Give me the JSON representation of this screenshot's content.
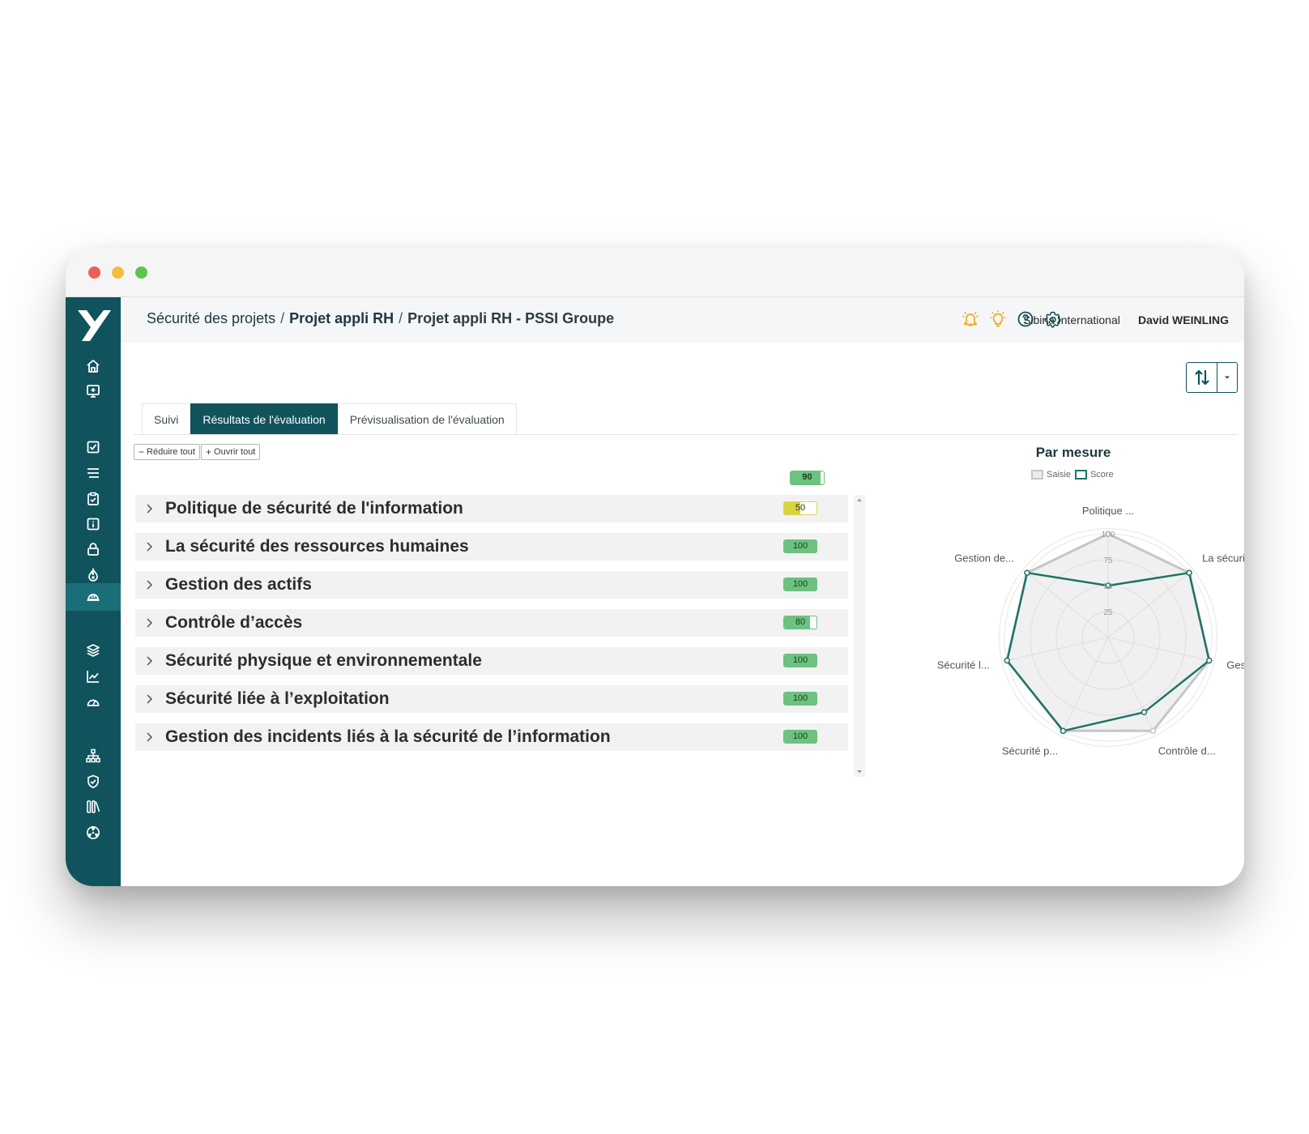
{
  "breadcrumb": {
    "level1": "Sécurité des projets",
    "level2": "Projet appli RH",
    "level3": "Projet appli RH - PSSI Groupe",
    "separator": "/"
  },
  "topbar": {
    "icons": [
      "bell-alert-icon",
      "lightbulb-icon",
      "help-icon",
      "settings-icon"
    ],
    "organization": "Sibina International",
    "user": "David WEINLING"
  },
  "sidebar": {
    "icons": [
      "logo-icon",
      "home-icon",
      "add-presentation-icon",
      "checkbox-icon",
      "list-icon",
      "clipboard-check-icon",
      "info-box-icon",
      "lock-icon",
      "fire-icon",
      "helmet-icon",
      "layers-icon",
      "chart-line-icon",
      "gauge-icon",
      "org-chart-icon",
      "shield-check-icon",
      "library-icon",
      "hazard-icon"
    ],
    "active": "helmet-icon"
  },
  "tabs": [
    "Suivi",
    "Résultats de l'évaluation",
    "Prévisualisation de l'évaluation"
  ],
  "active_tab": 1,
  "actions": {
    "collapse_all": "Réduire tout",
    "expand_all": "Ouvrir tout"
  },
  "overall_score": {
    "value": "90",
    "fraction": 0.9
  },
  "sections": [
    {
      "title": "Politique de sécurité de l'information",
      "score": "50",
      "fraction": 0.5,
      "level": "warning"
    },
    {
      "title": "La sécurité des ressources humaines",
      "score": "100",
      "fraction": 1.0,
      "level": "ok"
    },
    {
      "title": "Gestion des actifs",
      "score": "100",
      "fraction": 1.0,
      "level": "ok"
    },
    {
      "title": "Contrôle d’accès",
      "score": "80",
      "fraction": 0.8,
      "level": "ok"
    },
    {
      "title": "Sécurité physique et environnementale",
      "score": "100",
      "fraction": 1.0,
      "level": "ok"
    },
    {
      "title": "Sécurité liée à l’exploitation",
      "score": "100",
      "fraction": 1.0,
      "level": "ok"
    },
    {
      "title": "Gestion des incidents liés à la sécurité de l’information",
      "score": "100",
      "fraction": 1.0,
      "level": "ok"
    }
  ],
  "colors": {
    "brand": "#10535d",
    "ok": "#6cc27e",
    "warning": "#d8d341",
    "score_line": "#1e7567",
    "saisie_line": "#c6c6c6"
  },
  "chart_data": {
    "type": "radar",
    "title": "Par mesure",
    "axes": [
      "Politique ...",
      "La sécurit...",
      "Gestion de...",
      "Contrôle d...",
      "Sécurité p...",
      "Sécurité l...",
      "Gestion de..."
    ],
    "ticks": [
      "25",
      "50",
      "75",
      "100"
    ],
    "range": [
      0,
      100
    ],
    "legend_position": "top",
    "series": [
      {
        "name": "Saisie",
        "values": [
          100,
          100,
          100,
          100,
          100,
          100,
          100
        ]
      },
      {
        "name": "Score",
        "values": [
          50,
          100,
          100,
          80,
          100,
          100,
          100
        ]
      }
    ]
  }
}
